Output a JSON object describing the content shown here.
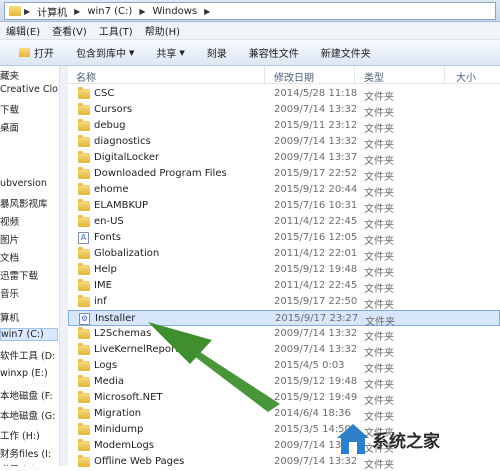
{
  "address": {
    "crumbs": [
      "计算机",
      "win7 (C:)",
      "Windows"
    ]
  },
  "menu": {
    "items": [
      "编辑(E)",
      "查看(V)",
      "工具(T)",
      "帮助(H)"
    ]
  },
  "toolbar": {
    "open": "打开",
    "include_library": "包含到库中",
    "share": "共享",
    "burn": "刻录",
    "compat": "兼容性文件",
    "new_folder": "新建文件夹"
  },
  "navpane": {
    "items": [
      "藏夹",
      "Creative Clo",
      "下载",
      "桌面",
      "ubversion",
      "暴风影视库",
      "视频",
      "图片",
      "文档",
      "迅雷下载",
      "音乐",
      "算机",
      "win7 (C:)",
      "软件工具 (D:",
      "winxp (E:)",
      "本地磁盘 (F:",
      "本地磁盘 (G:",
      "工作 (H:)",
      "财务files (I:",
      "书员 (J:)"
    ],
    "selected_index": 12
  },
  "columns": {
    "name": "名称",
    "date": "修改日期",
    "type": "类型",
    "size": "大小"
  },
  "rows": [
    {
      "name": "CSC",
      "date": "2014/5/28 11:18",
      "type": "文件夹",
      "icon": "folder"
    },
    {
      "name": "Cursors",
      "date": "2009/7/14 13:32",
      "type": "文件夹",
      "icon": "folder"
    },
    {
      "name": "debug",
      "date": "2015/9/11 23:12",
      "type": "文件夹",
      "icon": "folder"
    },
    {
      "name": "diagnostics",
      "date": "2009/7/14 13:32",
      "type": "文件夹",
      "icon": "folder"
    },
    {
      "name": "DigitalLocker",
      "date": "2009/7/14 13:37",
      "type": "文件夹",
      "icon": "folder"
    },
    {
      "name": "Downloaded Program Files",
      "date": "2015/9/17 22:52",
      "type": "文件夹",
      "icon": "folder"
    },
    {
      "name": "ehome",
      "date": "2015/9/12 20:44",
      "type": "文件夹",
      "icon": "folder"
    },
    {
      "name": "ELAMBKUP",
      "date": "2015/7/16 10:31",
      "type": "文件夹",
      "icon": "folder"
    },
    {
      "name": "en-US",
      "date": "2011/4/12 22:45",
      "type": "文件夹",
      "icon": "folder"
    },
    {
      "name": "Fonts",
      "date": "2015/7/16 12:05",
      "type": "文件夹",
      "icon": "fonts"
    },
    {
      "name": "Globalization",
      "date": "2011/4/12 22:01",
      "type": "文件夹",
      "icon": "folder"
    },
    {
      "name": "Help",
      "date": "2015/9/12 19:48",
      "type": "文件夹",
      "icon": "folder"
    },
    {
      "name": "IME",
      "date": "2011/4/12 22:45",
      "type": "文件夹",
      "icon": "folder"
    },
    {
      "name": "inf",
      "date": "2015/9/17 22:50",
      "type": "文件夹",
      "icon": "folder"
    },
    {
      "name": "Installer",
      "date": "2015/9/17 23:27",
      "type": "文件夹",
      "icon": "installer"
    },
    {
      "name": "L2Schemas",
      "date": "2009/7/14 13:32",
      "type": "文件夹",
      "icon": "folder"
    },
    {
      "name": "LiveKernelReports",
      "date": "2009/7/14 13:32",
      "type": "文件夹",
      "icon": "folder"
    },
    {
      "name": "Logs",
      "date": "2015/4/5 0:03",
      "type": "文件夹",
      "icon": "folder"
    },
    {
      "name": "Media",
      "date": "2015/9/12 19:48",
      "type": "文件夹",
      "icon": "folder"
    },
    {
      "name": "Microsoft.NET",
      "date": "2015/9/12 19:49",
      "type": "文件夹",
      "icon": "folder"
    },
    {
      "name": "Migration",
      "date": "2014/6/4 18:36",
      "type": "文件夹",
      "icon": "folder"
    },
    {
      "name": "Minidump",
      "date": "2015/3/5 14:50",
      "type": "文件夹",
      "icon": "folder"
    },
    {
      "name": "ModemLogs",
      "date": "2009/7/14 13:32",
      "type": "文件夹",
      "icon": "folder"
    },
    {
      "name": "Offline Web Pages",
      "date": "2009/7/14 13:32",
      "type": "文件夹",
      "icon": "folder"
    }
  ],
  "selected_row": 14,
  "watermark": {
    "text": "系统之家"
  },
  "colors": {
    "selection": "#d7e6fa",
    "arrow": "#3f8f2f"
  }
}
